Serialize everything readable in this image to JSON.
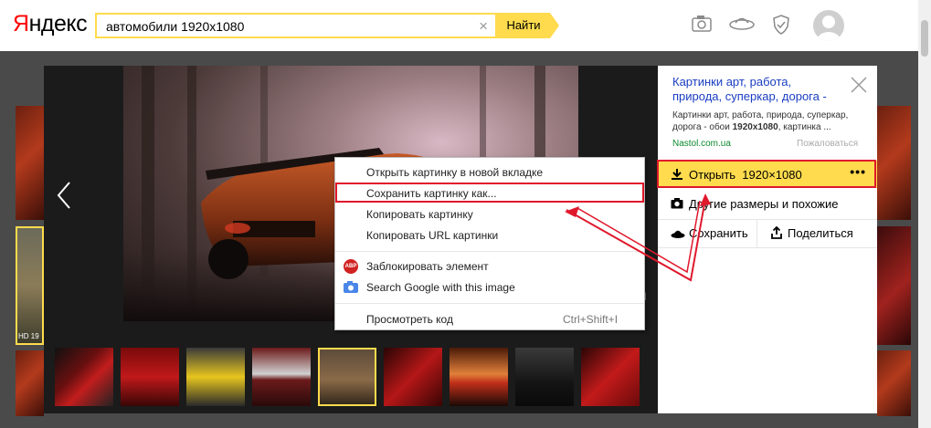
{
  "header": {
    "logo": "Яндекс",
    "search_value": "автомобили 1920x1080",
    "search_button": "Найти",
    "icons": [
      "camera-icon",
      "ufo-icon",
      "shield-icon",
      "avatar"
    ]
  },
  "viewer": {
    "thumb_label": "HD 19",
    "watermark": "Л"
  },
  "panel": {
    "title": "Картинки арт, работа, природа, суперкар, дорога -",
    "desc_prefix": "Картинки арт, работа, природа, суперкар, дорога - обои ",
    "desc_bold": "1920x1080",
    "desc_suffix": ", картинка ...",
    "site": "Nastol.com.ua",
    "report": "Пожаловаться",
    "open_label": "Открыть",
    "open_size": "1920×1080",
    "more": "•••",
    "other_sizes": "Другие размеры и похожие",
    "save": "Сохранить",
    "share": "Поделиться"
  },
  "context_menu": {
    "open_new_tab": "Открыть картинку в новой вкладке",
    "save_as": "Сохранить картинку как...",
    "copy_image": "Копировать картинку",
    "copy_url": "Копировать URL картинки",
    "abp_badge": "ABP",
    "block_element": "Заблокировать элемент",
    "search_google": "Search Google with this image",
    "inspect": "Просмотреть код",
    "inspect_shortcut": "Ctrl+Shift+I"
  },
  "colors": {
    "accent": "#ffdb4d",
    "highlight": "#e0182c",
    "link": "#1a3dc1",
    "site": "#0a8a2e"
  }
}
